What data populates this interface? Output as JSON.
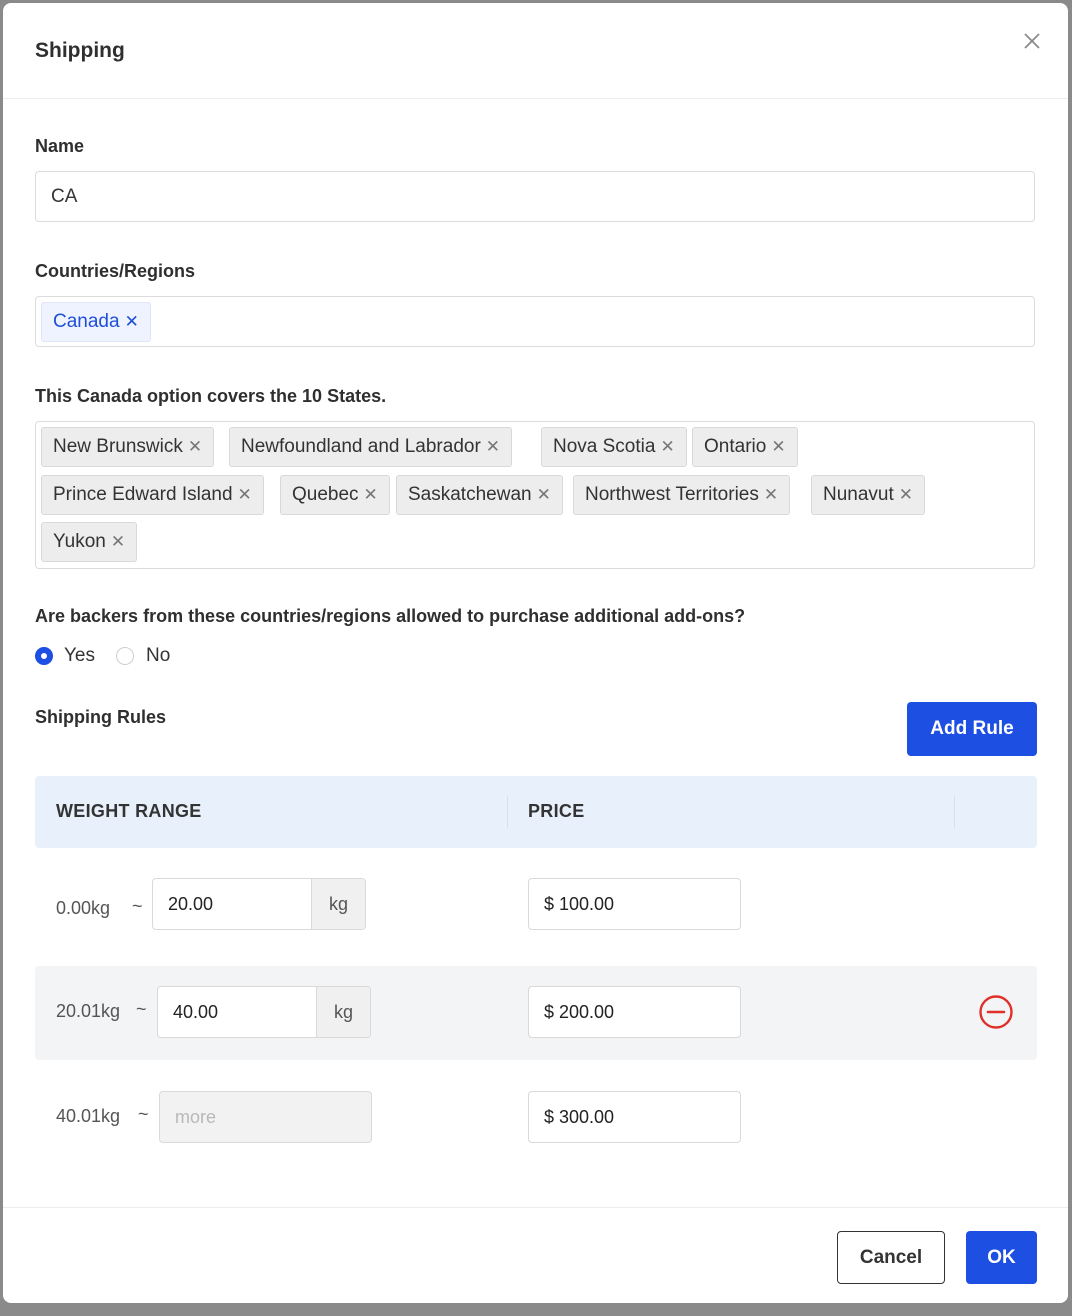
{
  "modal": {
    "title": "Shipping"
  },
  "name_field": {
    "label": "Name",
    "value": "CA"
  },
  "countries": {
    "label": "Countries/Regions",
    "tags": [
      "Canada"
    ]
  },
  "states": {
    "label": "This Canada option covers the 10 States.",
    "tags": [
      "New Brunswick",
      "Newfoundland and Labrador",
      "Nova Scotia",
      "Ontario",
      "Prince Edward Island",
      "Quebec",
      "Saskatchewan",
      "Northwest Territories",
      "Nunavut",
      "Yukon"
    ]
  },
  "addons": {
    "question": "Are backers from these countries/regions allowed to purchase additional add-ons?",
    "options": [
      "Yes",
      "No"
    ],
    "selected": "Yes"
  },
  "rules": {
    "label": "Shipping Rules",
    "add_button": "Add Rule",
    "columns": [
      "WEIGHT RANGE",
      "PRICE"
    ],
    "rows": [
      {
        "from": "0.00kg",
        "tilde": "~",
        "to": "20.00",
        "unit": "kg",
        "price": "$ 100.00"
      },
      {
        "from": "20.01kg",
        "tilde": "~",
        "to": "40.00",
        "unit": "kg",
        "price": "$ 200.00"
      },
      {
        "from": "40.01kg",
        "tilde": "~",
        "to_placeholder": "more",
        "price": "$ 300.00"
      }
    ]
  },
  "footer": {
    "cancel": "Cancel",
    "ok": "OK"
  },
  "colors": {
    "primary": "#1e4fe3",
    "remove_red": "#e0302a",
    "table_header_bg": "#e8f0fc"
  }
}
